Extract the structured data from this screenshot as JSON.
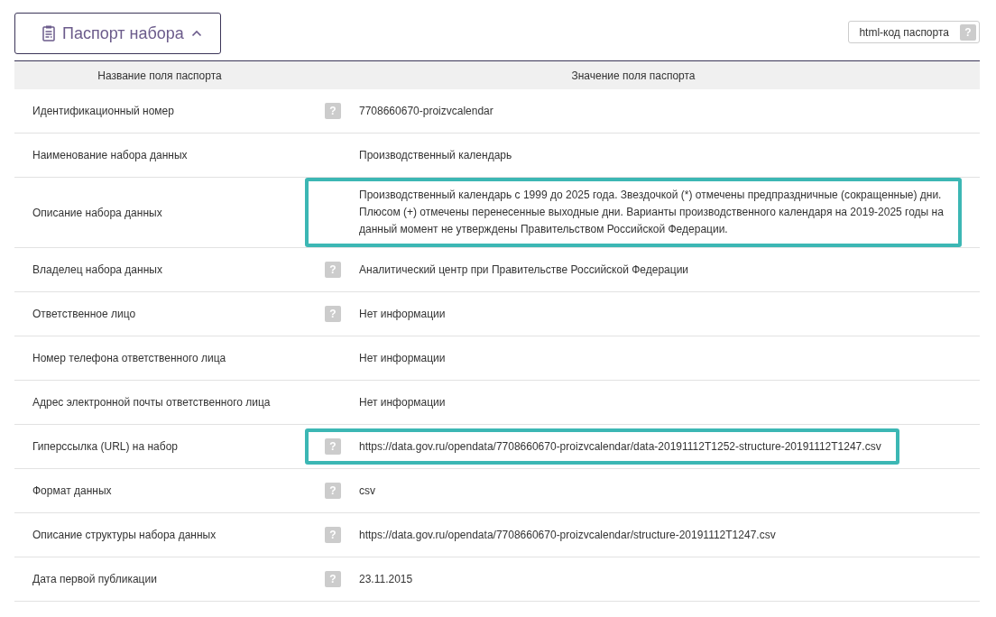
{
  "panel_toggle": {
    "label": "Паспорт набора",
    "expanded": true
  },
  "html_code_button": {
    "label": "html-код паспорта",
    "help": "?"
  },
  "table": {
    "columns": [
      "Название поля паспорта",
      "Значение поля паспорта"
    ],
    "rows": [
      {
        "name": "Идентификационный номер",
        "help": "?",
        "value": "7708660670-proizvcalendar",
        "highlighted": false
      },
      {
        "name": "Наименование набора данных",
        "value": "Производственный календарь",
        "highlighted": false
      },
      {
        "name": "Описание набора данных",
        "value": "Производственный календарь с 1999 до 2025 года. Звездочкой (*) отмечены предпраздничные (сокращенные) дни. Плюсом (+) отмечены перенесенные выходные дни. Варианты производственного календаря на 2019-2025 годы на данный момент не утверждены Правительством Российской Федерации.",
        "highlighted": true
      },
      {
        "name": "Владелец набора данных",
        "help": "?",
        "value": "Аналитический центр при Правительстве Российской Федерации",
        "highlighted": false
      },
      {
        "name": "Ответственное лицо",
        "help": "?",
        "value": "Нет информации",
        "highlighted": false
      },
      {
        "name": "Номер телефона ответственного лица",
        "value": "Нет информации",
        "highlighted": false
      },
      {
        "name": "Адрес электронной почты ответственного лица",
        "value": "Нет информации",
        "highlighted": false
      },
      {
        "name": "Гиперссылка (URL) на набор",
        "help": "?",
        "value": "https://data.gov.ru/opendata/7708660670-proizvcalendar/data-20191112T1252-structure-20191112T1247.csv",
        "highlighted": true
      },
      {
        "name": "Формат данных",
        "help": "?",
        "value": "csv",
        "highlighted": false
      },
      {
        "name": "Описание структуры набора данных",
        "help": "?",
        "value": "https://data.gov.ru/opendata/7708660670-proizvcalendar/structure-20191112T1247.csv",
        "highlighted": false
      },
      {
        "name": "Дата первой публикации",
        "help": "?",
        "value": "23.11.2015",
        "highlighted": false
      }
    ]
  }
}
